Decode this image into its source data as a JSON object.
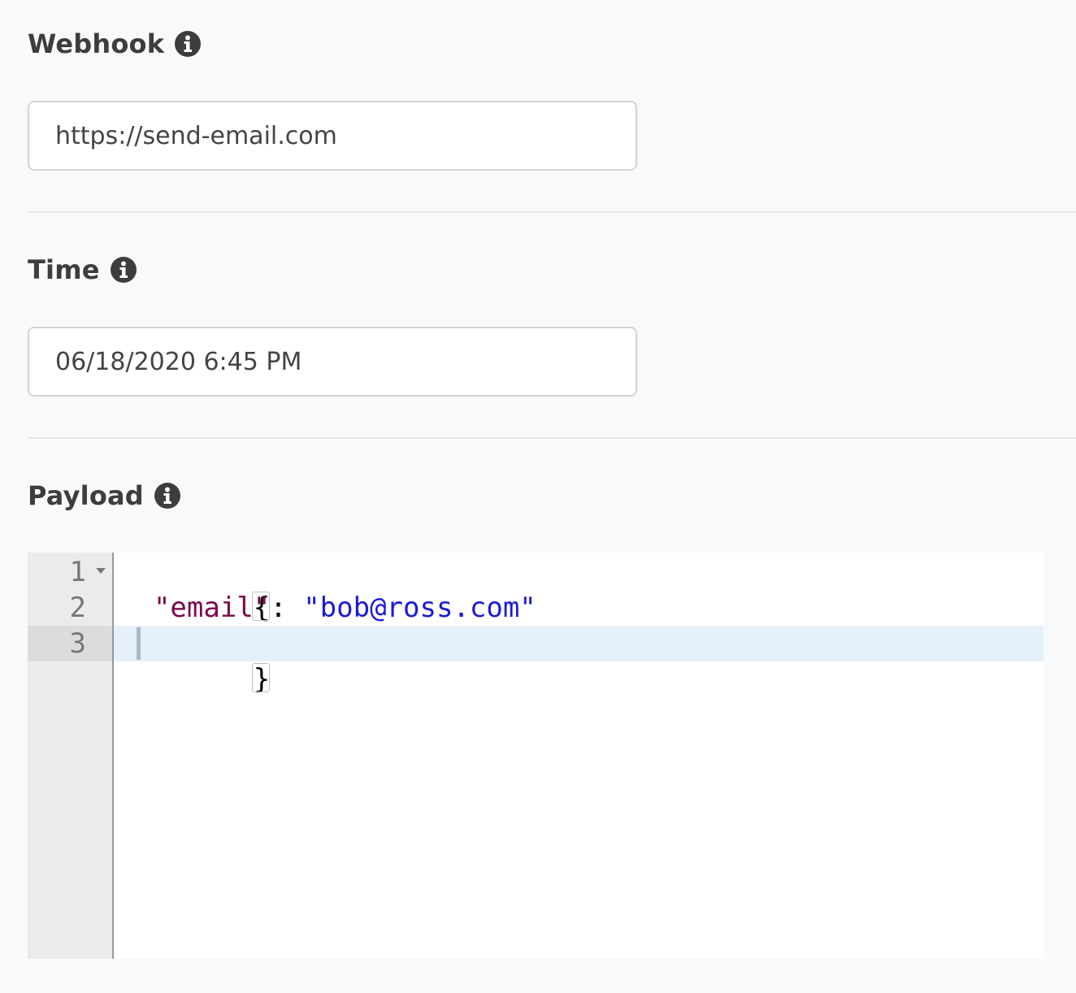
{
  "webhook": {
    "label": "Webhook",
    "value": "https://send-email.com",
    "info_icon": "info-circle-icon"
  },
  "time": {
    "label": "Time",
    "value": "06/18/2020 6:45 PM",
    "info_icon": "info-circle-icon"
  },
  "payload": {
    "label": "Payload",
    "info_icon": "info-circle-icon",
    "editor": {
      "line_numbers": [
        "1",
        "2",
        "3"
      ],
      "open_brace": "{",
      "indent": "  ",
      "key": "\"email\"",
      "colon": ": ",
      "string_value": "\"bob@ross.com\"",
      "close_brace": "}",
      "active_line": 3
    }
  },
  "colors": {
    "background": "#f8f9fb",
    "json_key": "#7a0a4d",
    "json_string": "#1a1ad6",
    "active_line_bg": "#e6f0fb",
    "gutter_bg": "#ebebeb"
  }
}
